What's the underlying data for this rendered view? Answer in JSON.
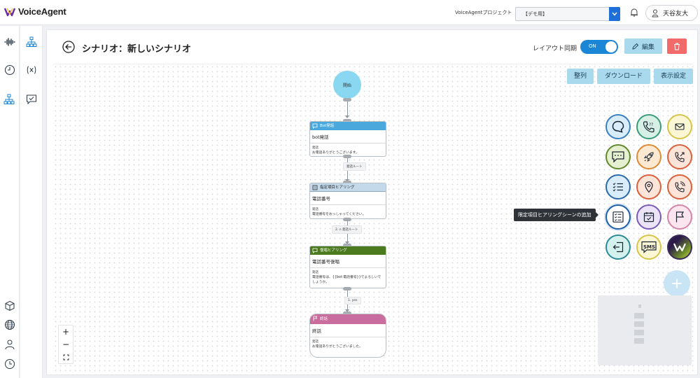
{
  "app": {
    "logo_text": "VoiceAgent"
  },
  "header": {
    "project_label": "VoiceAgentプロジェクト",
    "project_value": "【デモ用】",
    "user_name": "天谷友大"
  },
  "page": {
    "title": "シナリオ：新しいシナリオ",
    "sync_label": "レイアウト同期",
    "toggle_text": "ON",
    "edit_label": "編集"
  },
  "toolbar": {
    "align_label": "整列",
    "download_label": "ダウンロード",
    "display_label": "表示設定"
  },
  "flow": {
    "start_label": "開始",
    "nodes": [
      {
        "header": "Bot発話",
        "name": "bot発話",
        "sub": "発話",
        "text": "お電話ありがとうございます。"
      },
      {
        "header": "指定項目ヒアリング",
        "name": "電話番号",
        "sub": "発話",
        "text": "電話番号をおっしゃってください。"
      },
      {
        "header": "復唱ヒアリング",
        "name": "電話番号復唱",
        "sub": "発話",
        "text": "電話番号は、{{bot:電話番号}}でよろしいでしょうか。"
      },
      {
        "header": "終話",
        "name": "終話",
        "sub": "発話",
        "text": "お電話ありがとうございました。"
      }
    ],
    "edges": [
      "発話ルート",
      "発話ルート",
      "1. yes"
    ],
    "edge2_prefix": "2. n"
  },
  "palette": {
    "tooltip": "限定項目ヒアリングシーンの追加",
    "items": [
      "speech-bubble-icon",
      "phone-question-icon",
      "envelope-icon",
      "chat-dots-icon",
      "rocket-icon",
      "phone-forward-icon",
      "checklist-icon",
      "location-pin-icon",
      "phone-call-icon",
      "form-list-icon",
      "calendar-check-icon",
      "flag-icon",
      "exit-icon",
      "sms-icon",
      "brand-logo-icon"
    ],
    "sms_text": "SMS"
  },
  "zoom": {
    "in": "+",
    "out": "−"
  },
  "colors": {
    "accent": "#1b86d6",
    "node_bot": "#4aa8dd",
    "node_hearing": "#c4d9ea",
    "node_repeat": "#4c7a1f",
    "node_end": "#c86d9d",
    "delete": "#f26b6b"
  }
}
